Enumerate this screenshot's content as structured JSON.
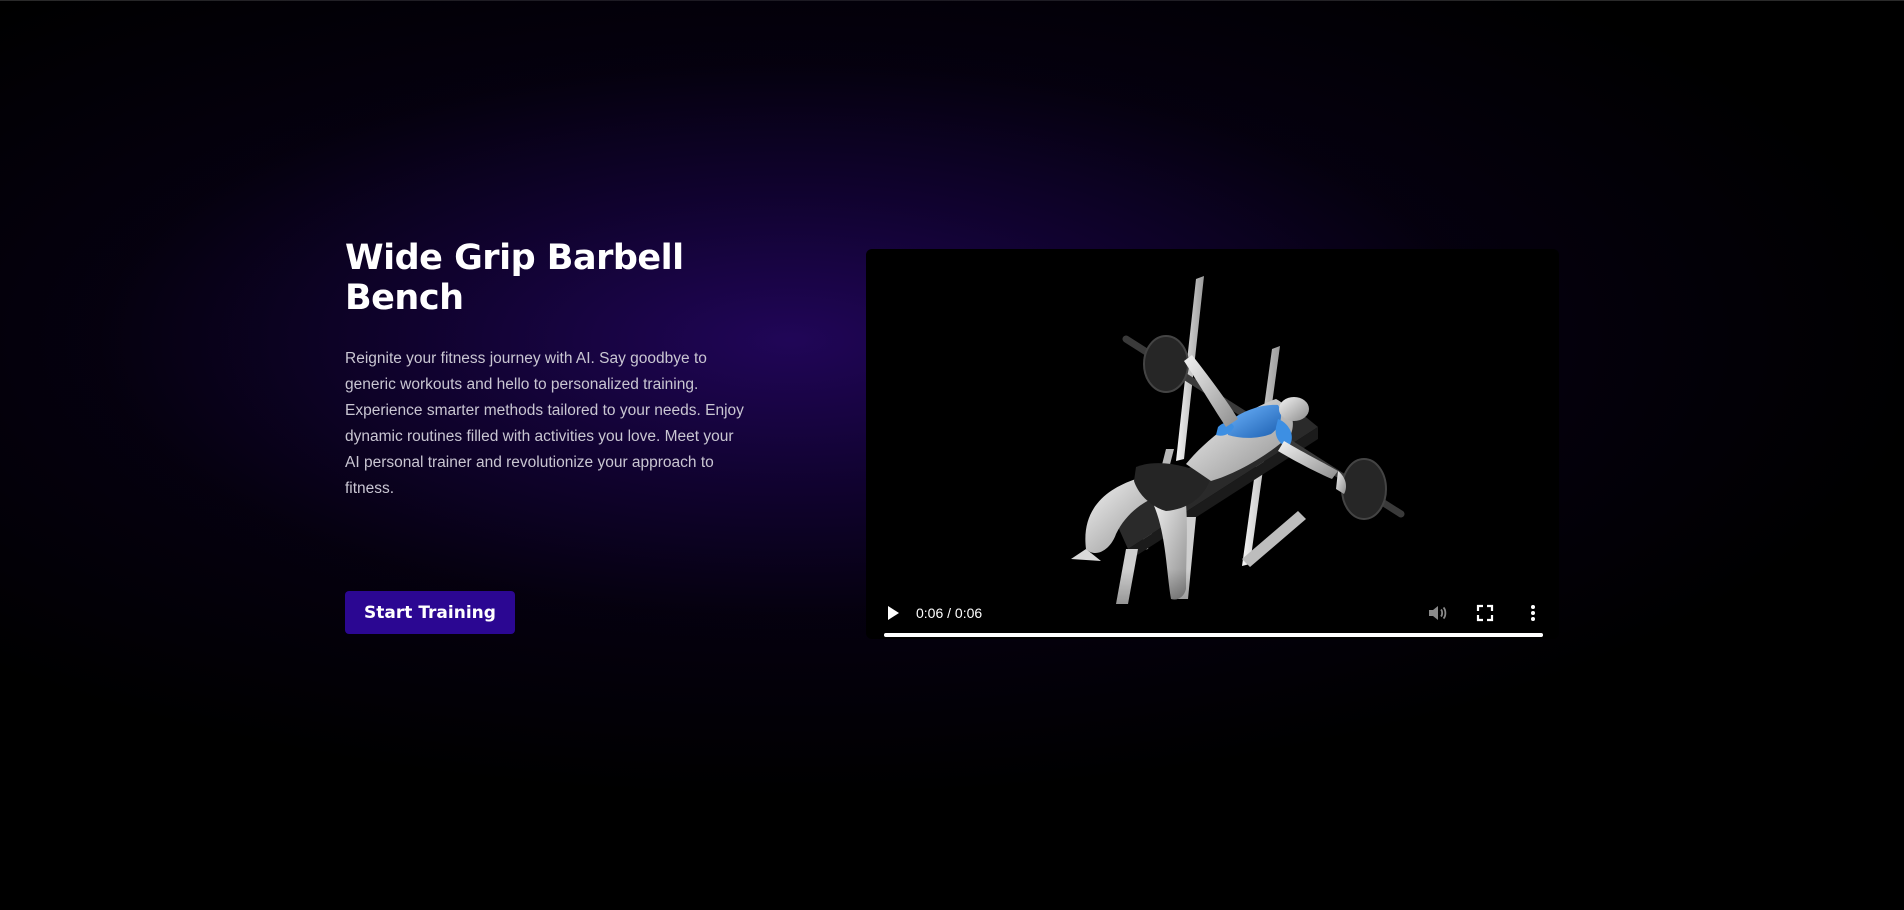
{
  "hero": {
    "title": "Wide Grip Barbell Bench",
    "description": "Reignite your fitness journey with AI. Say goodbye to generic workouts and hello to personalized training. Experience smarter methods tailored to your needs. Enjoy dynamic routines filled with activities you love. Meet your AI personal trainer and revolutionize your approach to fitness.",
    "cta_label": "Start Training"
  },
  "video": {
    "time_display": "0:06 / 0:06",
    "progress": 1.0,
    "icons": {
      "play": "play-icon",
      "volume": "volume-icon",
      "fullscreen": "fullscreen-icon",
      "more": "more-vertical-icon"
    }
  },
  "colors": {
    "background": "#000000",
    "glow": "#22065c",
    "button": "#2b0792",
    "highlight_muscle": "#2e7fd6"
  }
}
